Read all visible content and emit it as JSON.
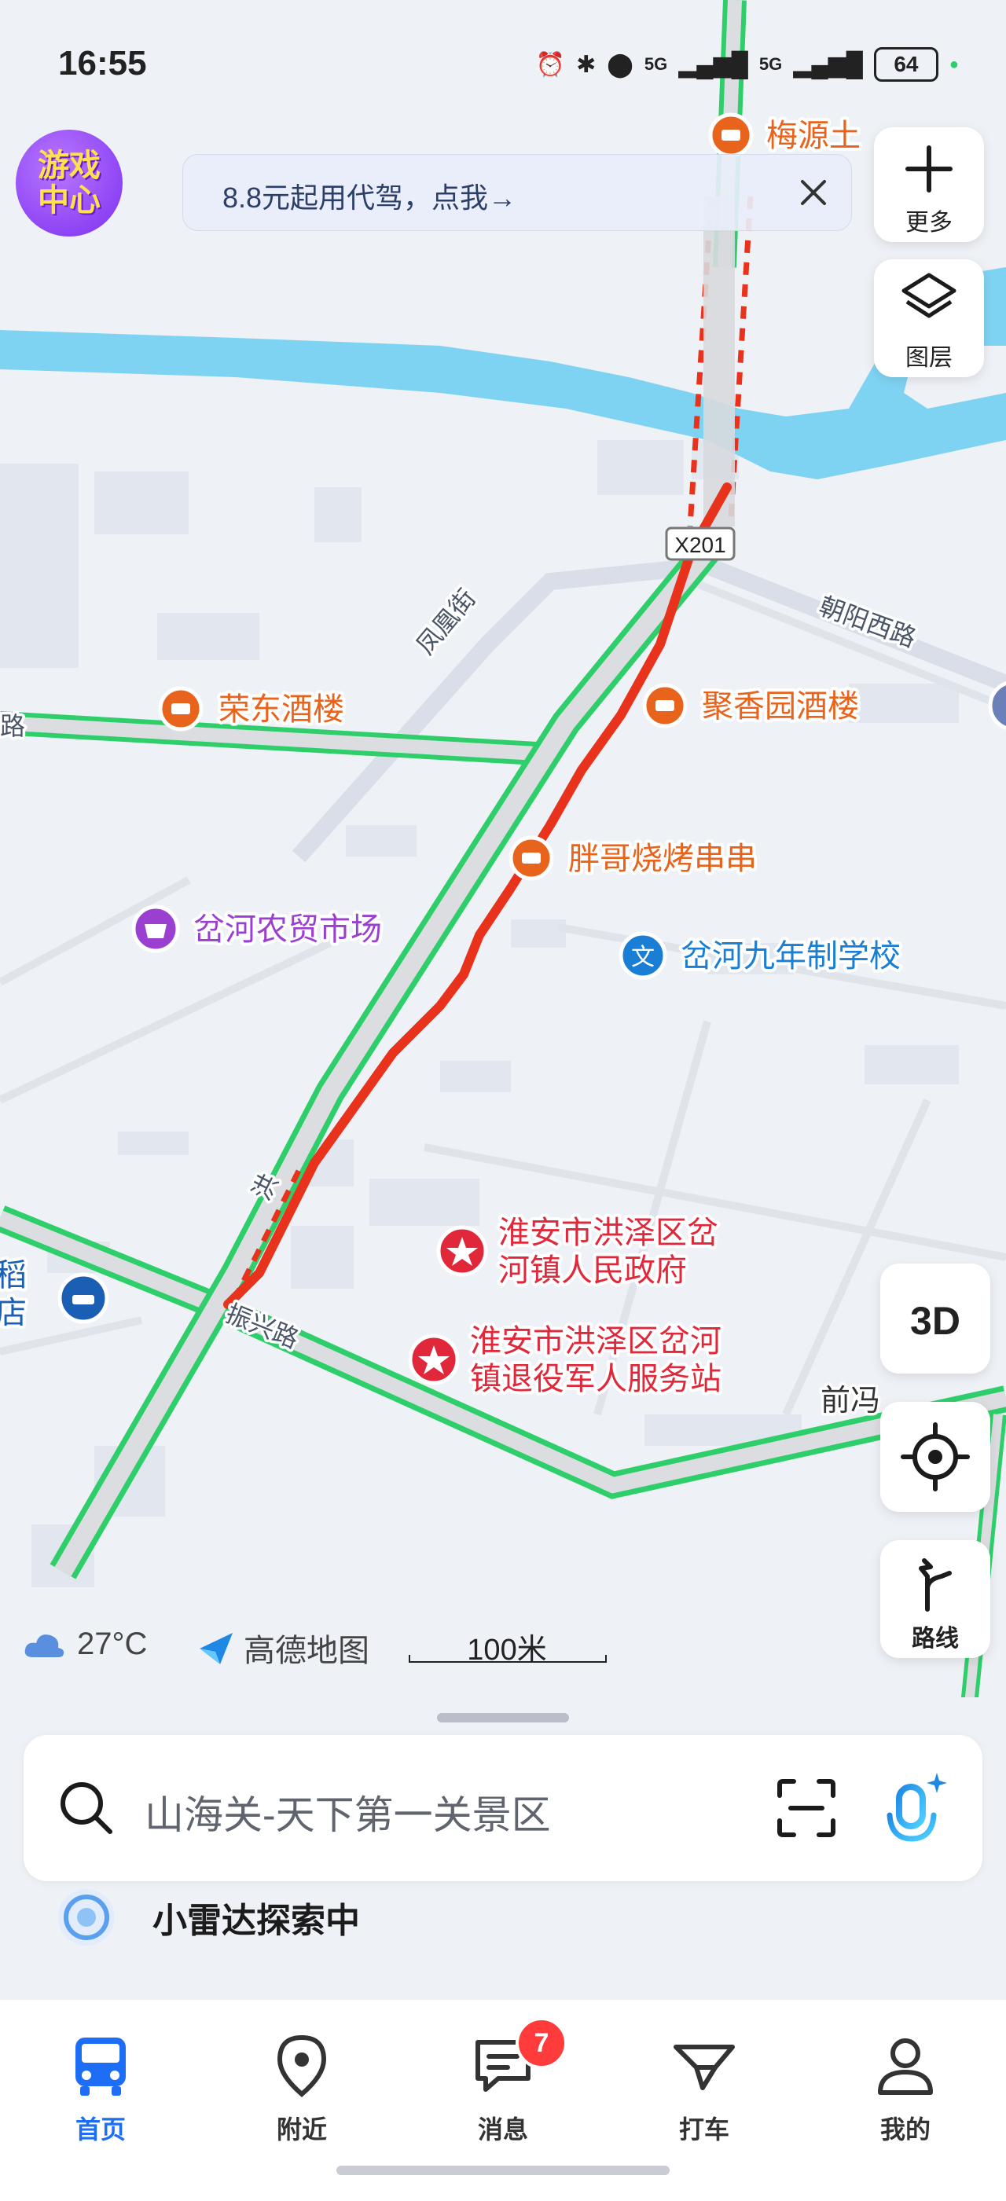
{
  "status_bar": {
    "time": "16:55",
    "battery": "64",
    "network_1": "5G",
    "network_2": "5G"
  },
  "game_center": {
    "label_line1": "游戏",
    "label_line2": "中心"
  },
  "promo": {
    "text": "8.8元起用代驾，点我→"
  },
  "side_controls": {
    "more_label": "更多",
    "layers_label": "图层",
    "three_d_label": "3D",
    "route_label": "路线"
  },
  "map": {
    "pois": [
      {
        "id": "meiyuan",
        "name": "梅源土",
        "color": "#e8631c",
        "icon": "restaurant-icon"
      },
      {
        "id": "rongdong",
        "name": "荣东酒楼",
        "color": "#e8631c",
        "icon": "restaurant-icon"
      },
      {
        "id": "juxiangyuan",
        "name": "聚香园酒楼",
        "color": "#e8631c",
        "icon": "restaurant-icon"
      },
      {
        "id": "pangge",
        "name": "胖哥烧烤串串",
        "color": "#e8631c",
        "icon": "restaurant-icon"
      },
      {
        "id": "market",
        "name": "岔河农贸市场",
        "color": "#9b3fd0",
        "icon": "basket-icon"
      },
      {
        "id": "school",
        "name": "岔河九年制学校",
        "color": "#1a7fd4",
        "icon": "school-icon"
      },
      {
        "id": "gov_line1",
        "name": "淮安市洪泽区岔",
        "color": "#e0283a",
        "icon": "government-icon"
      },
      {
        "id": "gov_line2",
        "name": "河镇人民政府",
        "color": "#e0283a"
      },
      {
        "id": "veterans_line1",
        "name": "淮安市洪泽区岔河",
        "color": "#e0283a",
        "icon": "government-icon"
      },
      {
        "id": "veterans_line2",
        "name": "镇退役军人服务站",
        "color": "#e0283a"
      },
      {
        "id": "hotel_line1",
        "name": "稻",
        "color": "#1a5fb4",
        "icon": "hotel-icon"
      },
      {
        "id": "hotel_line2",
        "name": "店",
        "color": "#1a5fb4"
      }
    ],
    "roads": [
      {
        "id": "fenghuang",
        "name": "凤凰街"
      },
      {
        "id": "chaoyang",
        "name": "朝阳西路"
      },
      {
        "id": "zhenxing",
        "name": "振兴路"
      },
      {
        "id": "left_road",
        "name": "路"
      },
      {
        "id": "qianfeng",
        "name": "前冯"
      },
      {
        "id": "partial",
        "name": "洪"
      }
    ],
    "route_marker": "X201"
  },
  "map_footer": {
    "temperature": "27°C",
    "brand": "高德地图",
    "scale": "100米"
  },
  "search": {
    "placeholder": "山海关-天下第一关景区"
  },
  "radar": {
    "text": "小雷达探索中"
  },
  "tabs": [
    {
      "id": "home",
      "label": "首页",
      "active": true,
      "icon": "bus-icon"
    },
    {
      "id": "nearby",
      "label": "附近",
      "active": false,
      "icon": "location-pin-icon"
    },
    {
      "id": "messages",
      "label": "消息",
      "active": false,
      "icon": "message-icon",
      "badge": "7"
    },
    {
      "id": "taxi",
      "label": "打车",
      "active": false,
      "icon": "taxi-icon"
    },
    {
      "id": "mine",
      "label": "我的",
      "active": false,
      "icon": "user-icon"
    }
  ],
  "colors": {
    "accent": "#1e6ef5",
    "water": "#7fd3f2",
    "road_green": "#2ecf6a",
    "route_red": "#e8321c"
  }
}
